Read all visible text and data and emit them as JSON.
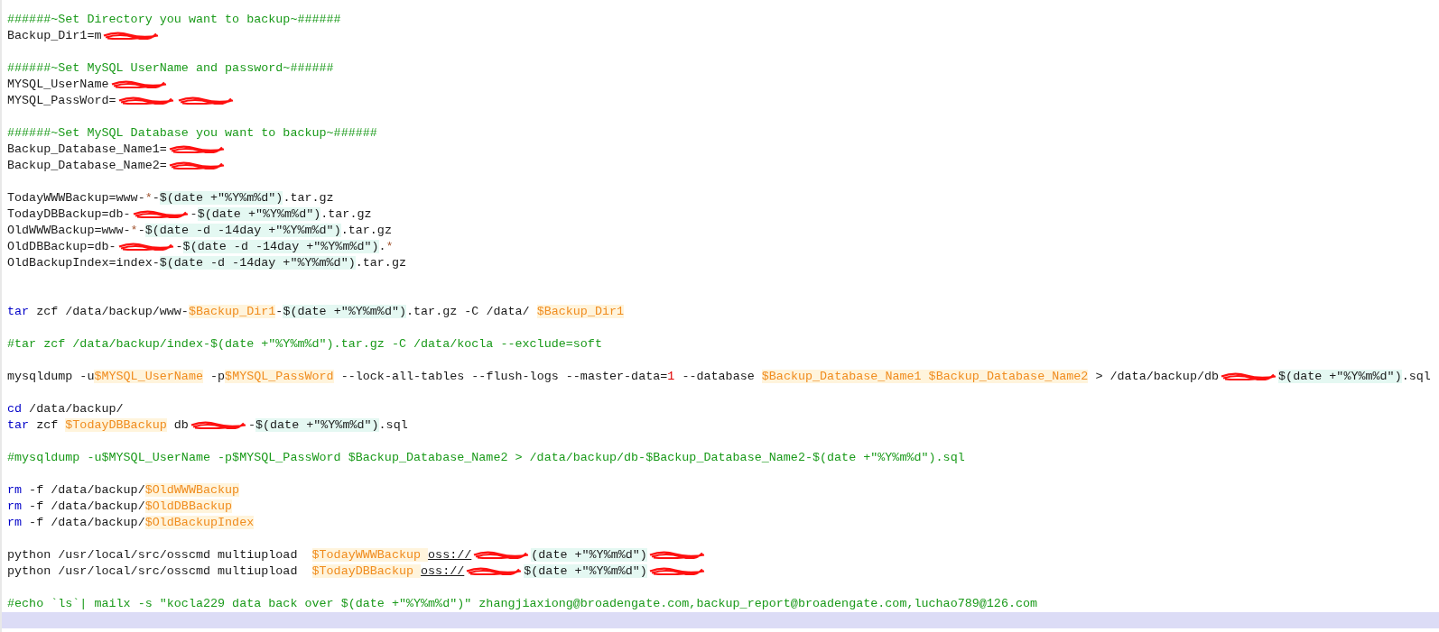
{
  "lines": [
    {
      "current": false,
      "tokens": [
        {
          "kind": "comment",
          "text": "######~Set Directory you want to backup~######"
        }
      ]
    },
    {
      "current": false,
      "tokens": [
        {
          "kind": "plain",
          "text": "Backup_Dir1=m"
        },
        {
          "kind": "redaction"
        }
      ]
    },
    {
      "current": false
    },
    {
      "current": false,
      "tokens": [
        {
          "kind": "comment",
          "text": "######~Set MySQL UserName and password~######"
        }
      ]
    },
    {
      "current": false,
      "tokens": [
        {
          "kind": "plain",
          "text": "MYSQL_UserName"
        },
        {
          "kind": "redaction"
        }
      ]
    },
    {
      "current": false,
      "tokens": [
        {
          "kind": "plain",
          "text": "MYSQL_PassWord="
        },
        {
          "kind": "redaction"
        },
        {
          "kind": "redaction"
        }
      ]
    },
    {
      "current": false
    },
    {
      "current": false,
      "tokens": [
        {
          "kind": "comment",
          "text": "######~Set MySQL Database you want to backup~######"
        }
      ]
    },
    {
      "current": false,
      "tokens": [
        {
          "kind": "plain",
          "text": "Backup_Database_Name1="
        },
        {
          "kind": "redaction"
        }
      ]
    },
    {
      "current": false,
      "tokens": [
        {
          "kind": "plain",
          "text": "Backup_Database_Name2="
        },
        {
          "kind": "redaction"
        }
      ]
    },
    {
      "current": false
    },
    {
      "current": false,
      "tokens": [
        {
          "kind": "plain",
          "text": "TodayWWWBackup=www-"
        },
        {
          "kind": "operator",
          "text": "*"
        },
        {
          "kind": "plain",
          "text": "-"
        },
        {
          "kind": "subst",
          "text": "$(date +\"%Y%m%d\")"
        },
        {
          "kind": "plain",
          "text": ".tar.gz"
        }
      ]
    },
    {
      "current": false,
      "tokens": [
        {
          "kind": "plain",
          "text": "TodayDBBackup=db-"
        },
        {
          "kind": "redaction"
        },
        {
          "kind": "plain",
          "text": "-"
        },
        {
          "kind": "subst",
          "text": "$(date +\"%Y%m%d\")"
        },
        {
          "kind": "plain",
          "text": ".tar.gz"
        }
      ]
    },
    {
      "current": false,
      "tokens": [
        {
          "kind": "plain",
          "text": "OldWWWBackup=www-"
        },
        {
          "kind": "operator",
          "text": "*"
        },
        {
          "kind": "plain",
          "text": "-"
        },
        {
          "kind": "subst",
          "text": "$(date -d -14day +\"%Y%m%d\")"
        },
        {
          "kind": "plain",
          "text": ".tar.gz"
        }
      ]
    },
    {
      "current": false,
      "tokens": [
        {
          "kind": "plain",
          "text": "OldDBBackup=db-"
        },
        {
          "kind": "redaction"
        },
        {
          "kind": "plain",
          "text": "-"
        },
        {
          "kind": "subst",
          "text": "$(date -d -14day +\"%Y%m%d\")"
        },
        {
          "kind": "plain",
          "text": "."
        },
        {
          "kind": "operator",
          "text": "*"
        }
      ]
    },
    {
      "current": false,
      "tokens": [
        {
          "kind": "plain",
          "text": "OldBackupIndex=index-"
        },
        {
          "kind": "subst",
          "text": "$(date -d -14day +\"%Y%m%d\")"
        },
        {
          "kind": "plain",
          "text": ".tar.gz"
        }
      ]
    },
    {
      "current": false
    },
    {
      "current": false
    },
    {
      "current": false,
      "tokens": [
        {
          "kind": "keyword",
          "text": "tar"
        },
        {
          "kind": "plain",
          "text": " zcf /data/backup/www-"
        },
        {
          "kind": "variable",
          "text": "$Backup_Dir1"
        },
        {
          "kind": "plain",
          "text": "-"
        },
        {
          "kind": "subst",
          "text": "$(date +\"%Y%m%d\")"
        },
        {
          "kind": "plain",
          "text": ".tar.gz -C /data/ "
        },
        {
          "kind": "variable",
          "text": "$Backup_Dir1"
        }
      ]
    },
    {
      "current": false
    },
    {
      "current": false,
      "tokens": [
        {
          "kind": "comment",
          "text": "#tar zcf /data/backup/index-$(date +\"%Y%m%d\").tar.gz -C /data/kocla --exclude=soft"
        }
      ]
    },
    {
      "current": false
    },
    {
      "current": false,
      "tokens": [
        {
          "kind": "plain",
          "text": "mysqldump -u"
        },
        {
          "kind": "variable",
          "text": "$MYSQL_UserName"
        },
        {
          "kind": "plain",
          "text": " -p"
        },
        {
          "kind": "variable",
          "text": "$MYSQL_PassWord"
        },
        {
          "kind": "plain",
          "text": " --lock-all-tables --flush-logs --master-data="
        },
        {
          "kind": "number",
          "text": "1"
        },
        {
          "kind": "plain",
          "text": " --database "
        },
        {
          "kind": "variable",
          "text": "$Backup_Database_Name1 "
        },
        {
          "kind": "variable",
          "text": "$Backup_Database_Name2"
        },
        {
          "kind": "plain",
          "text": " > /data/backup/db"
        },
        {
          "kind": "redaction"
        },
        {
          "kind": "subst",
          "text": "$(date +\"%Y%m%d\")"
        },
        {
          "kind": "plain",
          "text": ".sql"
        }
      ]
    },
    {
      "current": false
    },
    {
      "current": false,
      "tokens": [
        {
          "kind": "keyword",
          "text": "cd"
        },
        {
          "kind": "plain",
          "text": " /data/backup/"
        }
      ]
    },
    {
      "current": false,
      "tokens": [
        {
          "kind": "keyword",
          "text": "tar"
        },
        {
          "kind": "plain",
          "text": " zcf "
        },
        {
          "kind": "variable",
          "text": "$TodayDBBackup"
        },
        {
          "kind": "plain",
          "text": " db"
        },
        {
          "kind": "redaction"
        },
        {
          "kind": "plain",
          "text": "-"
        },
        {
          "kind": "subst",
          "text": "$(date +\"%Y%m%d\")"
        },
        {
          "kind": "plain",
          "text": ".sql"
        }
      ]
    },
    {
      "current": false
    },
    {
      "current": false,
      "tokens": [
        {
          "kind": "comment",
          "text": "#mysqldump -u$MYSQL_UserName -p$MYSQL_PassWord $Backup_Database_Name2 > /data/backup/db-$Backup_Database_Name2-$(date +\"%Y%m%d\").sql"
        }
      ]
    },
    {
      "current": false
    },
    {
      "current": false,
      "tokens": [
        {
          "kind": "keyword",
          "text": "rm"
        },
        {
          "kind": "plain",
          "text": " -f /data/backup/"
        },
        {
          "kind": "variable",
          "text": "$OldWWWBackup"
        }
      ]
    },
    {
      "current": false,
      "tokens": [
        {
          "kind": "keyword",
          "text": "rm"
        },
        {
          "kind": "plain",
          "text": " -f /data/backup/"
        },
        {
          "kind": "variable",
          "text": "$OldDBBackup"
        }
      ]
    },
    {
      "current": false,
      "tokens": [
        {
          "kind": "keyword",
          "text": "rm"
        },
        {
          "kind": "plain",
          "text": " -f /data/backup/"
        },
        {
          "kind": "variable",
          "text": "$OldBackupIndex"
        }
      ]
    },
    {
      "current": false
    },
    {
      "current": false,
      "tokens": [
        {
          "kind": "plain",
          "text": "python /usr/local/src/osscmd multiupload  "
        },
        {
          "kind": "variable",
          "text": "$TodayWWWBackup "
        },
        {
          "kind": "link",
          "text": "oss://"
        },
        {
          "kind": "redaction"
        },
        {
          "kind": "subst",
          "text": "(date +\"%Y%m%d\")"
        },
        {
          "kind": "redaction"
        }
      ]
    },
    {
      "current": false,
      "tokens": [
        {
          "kind": "plain",
          "text": "python /usr/local/src/osscmd multiupload  "
        },
        {
          "kind": "variable",
          "text": "$TodayDBBackup "
        },
        {
          "kind": "link",
          "text": "oss://"
        },
        {
          "kind": "redaction"
        },
        {
          "kind": "subst",
          "text": "$(date +\"%Y%m%d\")"
        },
        {
          "kind": "redaction"
        }
      ]
    },
    {
      "current": false
    },
    {
      "current": false,
      "tokens": [
        {
          "kind": "comment",
          "text": "#echo `ls`| mailx -s \"kocla229 data back over $(date +\"%Y%m%d\")\" zhangjiaxiong@broadengate.com,backup_report@broadengate.com,luchao789@126.com"
        }
      ]
    },
    {
      "current": true
    }
  ]
}
